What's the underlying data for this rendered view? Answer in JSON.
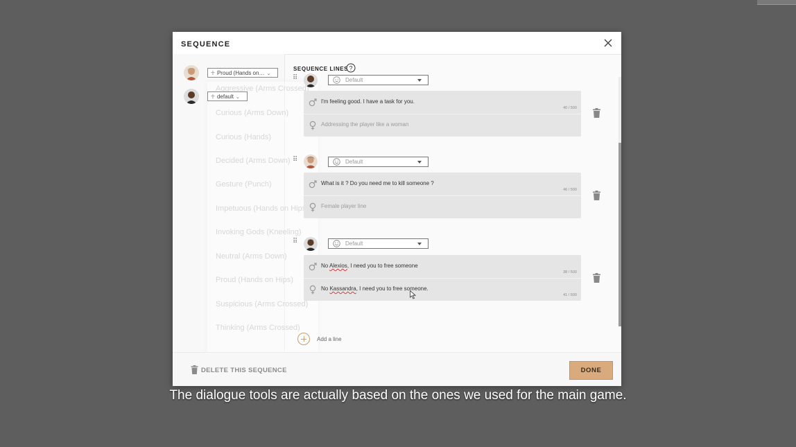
{
  "modal": {
    "title": "SEQUENCE",
    "sequence_lines_label": "SEQUENCE LINES",
    "add_line_label": "Add a line",
    "delete_label": "DELETE THIS SEQUENCE",
    "done_label": "DONE"
  },
  "speakers": [
    {
      "pose": "Proud (Hands on…"
    },
    {
      "pose": "default"
    }
  ],
  "ghost_list": [
    "Aggressive (Arms Crossed)",
    "Curious (Arms Down)",
    "Curious (Hands)",
    "Decided (Arms Down)",
    "Gesture (Punch)",
    "Impetuous (Hands on Hips)",
    "Invoking Gods (Kneeling)",
    "Neutral (Arms Down)",
    "Proud (Hands on Hips)",
    "Suspicious (Arms Crossed)",
    "Thinking (Arms Crossed)"
  ],
  "lines": [
    {
      "mood": "Default",
      "male_text": "I'm feeling good. I have a task for you.",
      "male_count": "40 / 500",
      "female_text": "Addressing the player like a woman",
      "female_count": ""
    },
    {
      "mood": "Default",
      "male_text": "What is it ? Do you need me to kill someone ?",
      "male_count": "46 / 500",
      "female_text": "Female player line",
      "female_count": ""
    },
    {
      "mood": "Default",
      "male_pre": "No ",
      "male_name": "Alexios",
      "male_post": ", I need you to free someone",
      "male_count": "38 / 500",
      "female_pre": "No ",
      "female_name": "Kassandra",
      "female_post": ", I need you to free someone.",
      "female_count": "41 / 500"
    }
  ],
  "subtitle": "The dialogue tools are actually based on the ones we used for the main game.",
  "colors": {
    "accent": "#d9aa7b",
    "backdrop": "#5f5e5e",
    "card": "#e5e5e5"
  }
}
